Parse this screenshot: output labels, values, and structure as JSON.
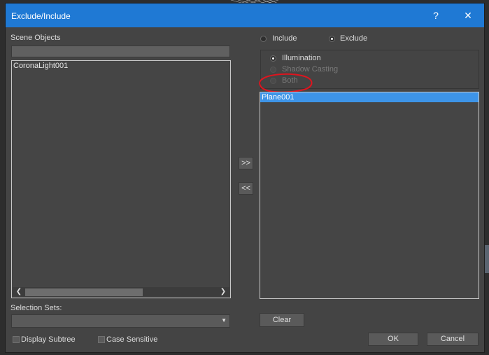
{
  "window": {
    "title": "Exclude/Include",
    "help_label": "?",
    "close_label": "✕"
  },
  "left": {
    "scene_objects_label": "Scene Objects",
    "filter_value": "",
    "objects": [
      "CoronaLight001"
    ],
    "selection_sets_label": "Selection Sets:",
    "selection_sets_value": ""
  },
  "transfer": {
    "add_label": ">>",
    "remove_label": "<<"
  },
  "right": {
    "mode_options": [
      {
        "label": "Include",
        "selected": false
      },
      {
        "label": "Exclude",
        "selected": true
      }
    ],
    "type_options": [
      {
        "label": "Illumination",
        "selected": true,
        "enabled": true
      },
      {
        "label": "Shadow Casting",
        "selected": false,
        "enabled": false
      },
      {
        "label": "Both",
        "selected": false,
        "enabled": false
      }
    ],
    "objects": [
      "Plane001"
    ],
    "clear_label": "Clear"
  },
  "bottom": {
    "display_subtree_label": "Display Subtree",
    "display_subtree_checked": false,
    "case_sensitive_label": "Case Sensitive",
    "case_sensitive_checked": false,
    "ok_label": "OK",
    "cancel_label": "Cancel"
  },
  "colors": {
    "title_bar": "#1f79d4",
    "dialog_bg": "#444444",
    "selection": "#3d94e8",
    "annotation_circle": "#e0141e"
  }
}
